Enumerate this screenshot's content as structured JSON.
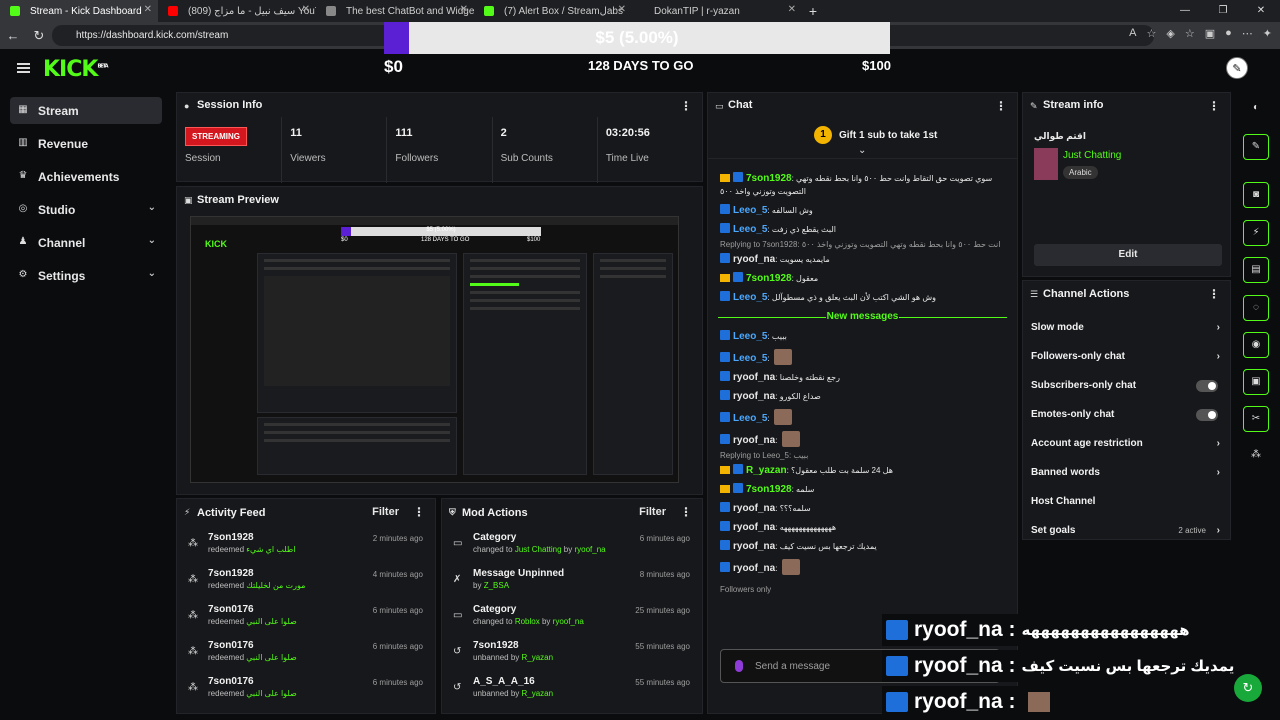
{
  "browser": {
    "tabs": [
      {
        "title": "Stream - Kick Dashboard",
        "color": "#53fc18"
      },
      {
        "title": "(809) سيف نبيل - ما مزاج YouTube",
        "color": "#ff0000"
      },
      {
        "title": "The best ChatBot and Widgets fo",
        "color": "#888888"
      },
      {
        "title": "(7) Alert Box / Streamلabs",
        "color": "#53fc18"
      },
      {
        "title": "تطوير المحتوى",
        "color": "#444444"
      },
      {
        "title": "DokanTIP | r-yazan",
        "color": "#222222"
      }
    ],
    "url": "https://dashboard.kick.com/stream"
  },
  "goal_overlay": {
    "label": "$5 (5.00%)",
    "min": "$0",
    "days": "128 DAYS TO GO",
    "max": "$100",
    "progress": 0.05
  },
  "app": {
    "logo": "KICK",
    "logo_sup": "BETA"
  },
  "sidebar": {
    "items": [
      {
        "label": "Stream",
        "icon": "dashboard-icon",
        "chev": ""
      },
      {
        "label": "Revenue",
        "icon": "bank-icon",
        "chev": ""
      },
      {
        "label": "Achievements",
        "icon": "trophy-icon",
        "chev": ""
      },
      {
        "label": "Studio",
        "icon": "gamepad-icon",
        "chev": "⌄"
      },
      {
        "label": "Channel",
        "icon": "user-icon",
        "chev": "⌄"
      },
      {
        "label": "Settings",
        "icon": "gear-icon",
        "chev": "⌄"
      }
    ]
  },
  "session": {
    "title": "Session Info",
    "status": "STREAMING",
    "status_label": "Session",
    "viewers": "11",
    "viewers_label": "Viewers",
    "followers": "111",
    "followers_label": "Followers",
    "subs": "2",
    "subs_label": "Sub Counts",
    "time": "03:20:56",
    "time_label": "Time Live"
  },
  "preview": {
    "title": "Stream Preview",
    "new_messages": "New messages",
    "send_placeholder": "Send a message",
    "pv_bar": "$5 (5.00%)",
    "pv_min": "$0",
    "pv_days": "128 DAYS TO GO",
    "pv_max": "$100"
  },
  "activity": {
    "title": "Activity Feed",
    "filter": "Filter",
    "rows": [
      {
        "name": "7son1928",
        "action": "redeemed",
        "reward": "اطلب اي شيء",
        "time": "2 minutes ago"
      },
      {
        "name": "7son1928",
        "action": "redeemed",
        "reward": "مورت من لخليلتك",
        "time": "4 minutes ago"
      },
      {
        "name": "7son0176",
        "action": "redeemed",
        "reward": "صلوا على النبي",
        "time": "6 minutes ago"
      },
      {
        "name": "7son0176",
        "action": "redeemed",
        "reward": "صلوا على النبي",
        "time": "6 minutes ago"
      },
      {
        "name": "7son0176",
        "action": "redeemed",
        "reward": "صلوا على النبي",
        "time": "6 minutes ago"
      }
    ]
  },
  "mod": {
    "title": "Mod Actions",
    "filter": "Filter",
    "rows": [
      {
        "name": "Category",
        "pre": "changed to",
        "a": "Just Chatting",
        "mid": "by",
        "b": "ryoof_na",
        "time": "6 minutes ago",
        "icon": "folder-icon"
      },
      {
        "name": "Message Unpinned",
        "pre": "by",
        "a": "Z_BSA",
        "mid": "",
        "b": "",
        "time": "8 minutes ago",
        "icon": "unpin-icon"
      },
      {
        "name": "Category",
        "pre": "changed to",
        "a": "Roblox",
        "mid": "by",
        "b": "ryoof_na",
        "time": "25 minutes ago",
        "icon": "folder-icon"
      },
      {
        "name": "7son1928",
        "pre": "unbanned by",
        "a": "R_yazan",
        "mid": "",
        "b": "",
        "time": "55 minutes ago",
        "icon": "undo-icon"
      },
      {
        "name": "A_S_A_A_16",
        "pre": "unbanned by",
        "a": "R_yazan",
        "mid": "",
        "b": "",
        "time": "55 minutes ago",
        "icon": "undo-icon"
      }
    ]
  },
  "chat": {
    "title": "Chat",
    "gift": "Gift 1 sub to take 1st",
    "messages_before": [
      {
        "user": "7son1928",
        "color": "#53fc18",
        "crown": true,
        "text": "سوي تصويت حق التقاط وانت حط ٥٠٠ وانا بحط نقطه وتهي التصويت وتوزني واخذ ٥٠٠"
      },
      {
        "user": "Leeo_5",
        "color": "#4aa8ff",
        "crown": false,
        "text": "وش السالفه"
      },
      {
        "user": "Leeo_5",
        "color": "#4aa8ff",
        "crown": false,
        "text": "البث يقطع ذي زفت"
      }
    ],
    "reply1": "Replying to 7son1928: انت حط ٥٠٠ وانا بحط نقطه وتهي التصويت وتوزني واخذ ٥٠٠",
    "messages_mid": [
      {
        "user": "ryoof_na",
        "color": "#e8e8e8",
        "crown": false,
        "text": "مايمديه يسويت"
      },
      {
        "user": "7son1928",
        "color": "#53fc18",
        "crown": true,
        "text": "معقول"
      },
      {
        "user": "Leeo_5",
        "color": "#4aa8ff",
        "crown": false,
        "text": "وش هو الشي اكتب لأن البث يعلق و ذي مسطوآلل"
      }
    ],
    "new_messages": "New messages",
    "messages_after": [
      {
        "user": "Leeo_5",
        "color": "#4aa8ff",
        "crown": false,
        "text": "ببيب"
      },
      {
        "user": "Leeo_5",
        "color": "#4aa8ff",
        "crown": false,
        "text": ""
      },
      {
        "user": "ryoof_na",
        "color": "#e8e8e8",
        "crown": false,
        "text": "رجع نقطته وخلصنا"
      },
      {
        "user": "ryoof_na",
        "color": "#e8e8e8",
        "crown": false,
        "text": "صداع الكورو"
      },
      {
        "user": "Leeo_5",
        "color": "#4aa8ff",
        "crown": false,
        "text": ""
      },
      {
        "user": "ryoof_na",
        "color": "#e8e8e8",
        "crown": false,
        "text": ""
      }
    ],
    "reply2": "Replying to Leeo_5: ببيب",
    "messages_end": [
      {
        "user": "R_yazan",
        "color": "#53fc18",
        "crown": true,
        "text": "هل 24 سلمة بت طلب معقول؟"
      },
      {
        "user": "7son1928",
        "color": "#53fc18",
        "crown": true,
        "text": "سلمه"
      },
      {
        "user": "ryoof_na",
        "color": "#e8e8e8",
        "crown": false,
        "text": "سلمه؟؟؟"
      },
      {
        "user": "ryoof_na",
        "color": "#e8e8e8",
        "crown": false,
        "text": "ههههههههههههههه"
      },
      {
        "user": "ryoof_na",
        "color": "#e8e8e8",
        "crown": false,
        "text": "يمديك ترجعها بس نسيت كيف"
      },
      {
        "user": "ryoof_na",
        "color": "#e8e8e8",
        "crown": false,
        "text": ""
      }
    ],
    "followers_only": "Followers only",
    "placeholder": "Send a message",
    "send": "Chat"
  },
  "stream_info": {
    "title": "Stream info",
    "stream_title": "اقتم طوالي",
    "category": "Just Chatting",
    "tag": "Arabic",
    "edit": "Edit"
  },
  "channel_actions": {
    "title": "Channel Actions",
    "rows": [
      {
        "label": "Slow mode",
        "kind": "chev",
        "extra": ""
      },
      {
        "label": "Followers-only chat",
        "kind": "chev",
        "extra": ""
      },
      {
        "label": "Subscribers-only chat",
        "kind": "toggle",
        "extra": ""
      },
      {
        "label": "Emotes-only chat",
        "kind": "toggle",
        "extra": ""
      },
      {
        "label": "Account age restriction",
        "kind": "chev",
        "extra": ""
      },
      {
        "label": "Banned words",
        "kind": "chev",
        "extra": ""
      },
      {
        "label": "Host Channel",
        "kind": "none",
        "extra": ""
      },
      {
        "label": "Set goals",
        "kind": "chev",
        "extra": "2 active"
      }
    ]
  },
  "captions": [
    {
      "name": "ryoof_na :",
      "text": "ههههههههههههههههه"
    },
    {
      "name": "ryoof_na :",
      "text": "يمديك ترجعها بس نسيت كيف"
    },
    {
      "name": "ryoof_na :",
      "text": ""
    }
  ]
}
